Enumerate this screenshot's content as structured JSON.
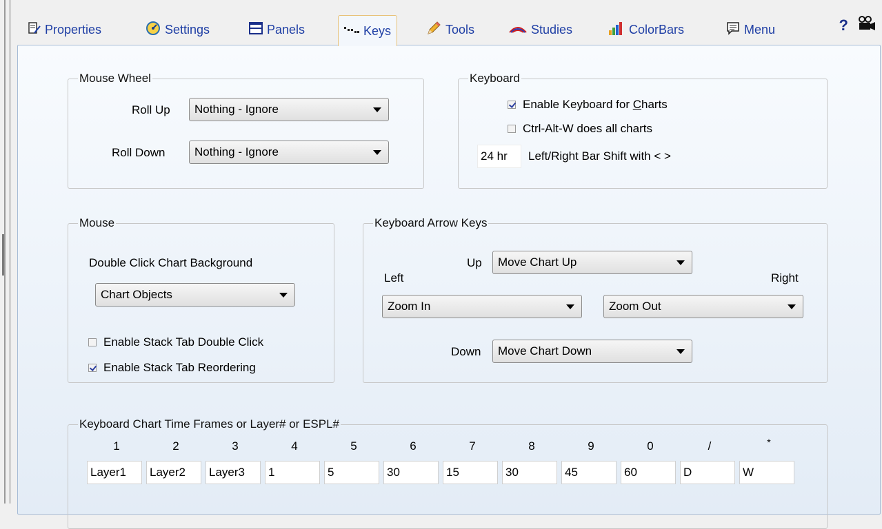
{
  "tabs": [
    {
      "label": "Properties",
      "icon": "properties-icon"
    },
    {
      "label": "Settings",
      "icon": "settings-gauge-icon"
    },
    {
      "label": "Panels",
      "icon": "panels-icon"
    },
    {
      "label": "Keys",
      "icon": "keys-icon",
      "active": true
    },
    {
      "label": "Tools",
      "icon": "pencil-icon"
    },
    {
      "label": "Studies",
      "icon": "studies-waves-icon"
    },
    {
      "label": "ColorBars",
      "icon": "colorbars-icon"
    },
    {
      "label": "Menu",
      "icon": "menu-icon"
    }
  ],
  "toolbar": {
    "help": "?"
  },
  "mouse_wheel": {
    "title": "Mouse Wheel",
    "roll_up_label": "Roll Up",
    "roll_up_value": "Nothing - Ignore",
    "roll_down_label": "Roll Down",
    "roll_down_value": "Nothing - Ignore"
  },
  "keyboard": {
    "title": "Keyboard",
    "enable_label_pre": "Enable Keyboard for ",
    "enable_label_ul": "C",
    "enable_label_post": "harts",
    "enable_checked": true,
    "ctrl_alt_label": "Ctrl-Alt-W does all charts",
    "ctrl_alt_checked": false,
    "shift_value": "24 hr",
    "shift_label": "Left/Right Bar Shift with < >"
  },
  "mouse": {
    "title": "Mouse",
    "dbl_click_label": "Double Click Chart Background",
    "dbl_click_value": "Chart Objects",
    "stack_dbl_label": "Enable Stack Tab Double Click",
    "stack_dbl_checked": false,
    "stack_reorder_label": "Enable Stack Tab Reordering",
    "stack_reorder_checked": true
  },
  "arrow_keys": {
    "title": "Keyboard Arrow Keys",
    "up_label": "Up",
    "up_value": "Move Chart Up",
    "left_label": "Left",
    "left_value": "Zoom In",
    "right_label": "Right",
    "right_value": "Zoom Out",
    "down_label": "Down",
    "down_value": "Move Chart Down"
  },
  "time_frames": {
    "title": "Keyboard Chart Time Frames  or  Layer#  or  ESPL#",
    "keys": [
      "1",
      "2",
      "3",
      "4",
      "5",
      "6",
      "7",
      "8",
      "9",
      "0",
      "/",
      "*"
    ],
    "values": [
      "Layer1",
      "Layer2",
      "Layer3",
      "1",
      "5",
      "30",
      "15",
      "30",
      "45",
      "60",
      "D",
      "W"
    ]
  }
}
